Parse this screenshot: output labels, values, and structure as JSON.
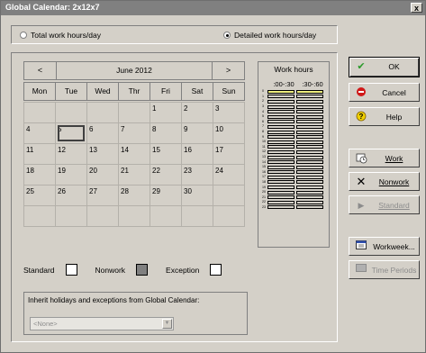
{
  "window": {
    "title": "Global Calendar: 2x12x7",
    "close_glyph": "x"
  },
  "radios": {
    "total": {
      "label": "Total work hours/day",
      "checked": false
    },
    "detailed": {
      "label": "Detailed work hours/day",
      "checked": true
    }
  },
  "calendar": {
    "prev": "<",
    "next": ">",
    "month": "June 2012",
    "daynames": [
      "Mon",
      "Tue",
      "Wed",
      "Thr",
      "Fri",
      "Sat",
      "Sun"
    ],
    "selected_day": "5",
    "cells": [
      "",
      "",
      "",
      "",
      "1",
      "2",
      "3",
      "4",
      "5",
      "6",
      "7",
      "8",
      "9",
      "10",
      "11",
      "12",
      "13",
      "14",
      "15",
      "16",
      "17",
      "18",
      "19",
      "20",
      "21",
      "22",
      "23",
      "24",
      "25",
      "26",
      "27",
      "28",
      "29",
      "30",
      "",
      "",
      "",
      "",
      "",
      "",
      "",
      ""
    ]
  },
  "work_hours": {
    "title": "Work hours",
    "col1": ":00-:30",
    "col2": ":30-:60",
    "hours": [
      "0",
      "1",
      "2",
      "3",
      "4",
      "5",
      "6",
      "7",
      "8",
      "9",
      "10",
      "11",
      "12",
      "13",
      "14",
      "15",
      "16",
      "17",
      "18",
      "19",
      "20",
      "21",
      "22",
      "23"
    ],
    "highlight_color": "#f0f080"
  },
  "legend": {
    "standard": "Standard",
    "nonwork": "Nonwork",
    "exception": "Exception",
    "nonwork_color": "#808080"
  },
  "inherit": {
    "label": "Inherit holidays and exceptions from Global Calendar:",
    "value": "<None>"
  },
  "buttons": {
    "ok": {
      "label": "OK",
      "icon": "check-icon"
    },
    "cancel": {
      "label": "Cancel",
      "icon": "stop-icon"
    },
    "help": {
      "label": "Help",
      "icon": "question-icon"
    },
    "work": {
      "label": "Work",
      "icon": "clock-icon"
    },
    "nonwork": {
      "label": "Nonwork",
      "icon": "x-icon"
    },
    "standard": {
      "label": "Standard",
      "icon": "play-icon"
    },
    "workweek": {
      "label": "Workweek...",
      "icon": "workweek-icon"
    },
    "time_periods": {
      "label": "Time Periods",
      "icon": "periods-icon"
    }
  }
}
